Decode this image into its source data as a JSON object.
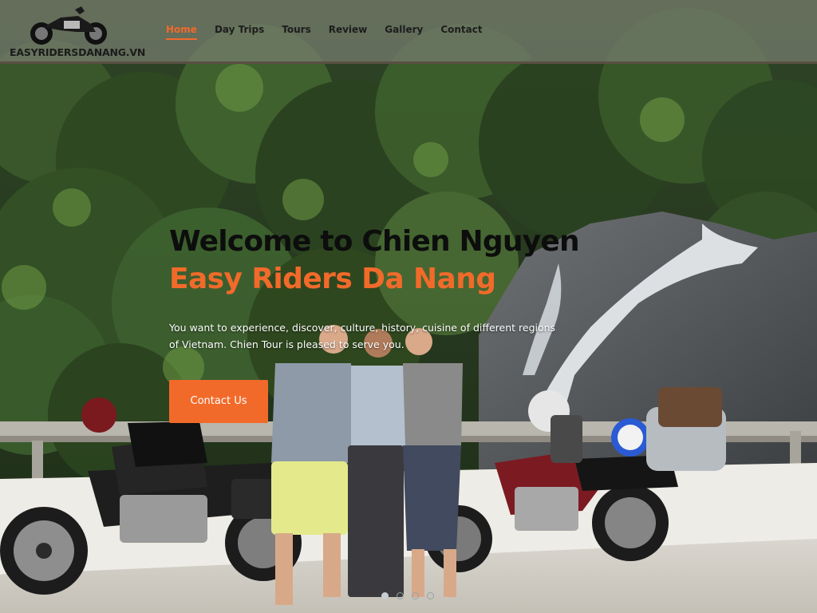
{
  "header": {
    "logo_text": "EASYRIDERSDANANG.VN",
    "logo_icon": "motorcycle-icon",
    "nav": [
      {
        "label": "Home",
        "active": true
      },
      {
        "label": "Day Trips",
        "active": false
      },
      {
        "label": "Tours",
        "active": false
      },
      {
        "label": "Review",
        "active": false
      },
      {
        "label": "Gallery",
        "active": false
      },
      {
        "label": "Contact",
        "active": false
      }
    ]
  },
  "hero": {
    "title_line1": "Welcome to Chien Nguyen",
    "title_line2": "Easy Riders Da Nang",
    "text": "You want to experience, discover, culture, history, cuisine of different regions of Vietnam. Chien Tour is pleased to serve you.",
    "cta_label": "Contact Us"
  },
  "slider": {
    "count": 4,
    "active_index": 0
  },
  "colors": {
    "accent": "#f26a2a",
    "title_dark": "#0d0d0d",
    "header_bg": "#787e70"
  }
}
